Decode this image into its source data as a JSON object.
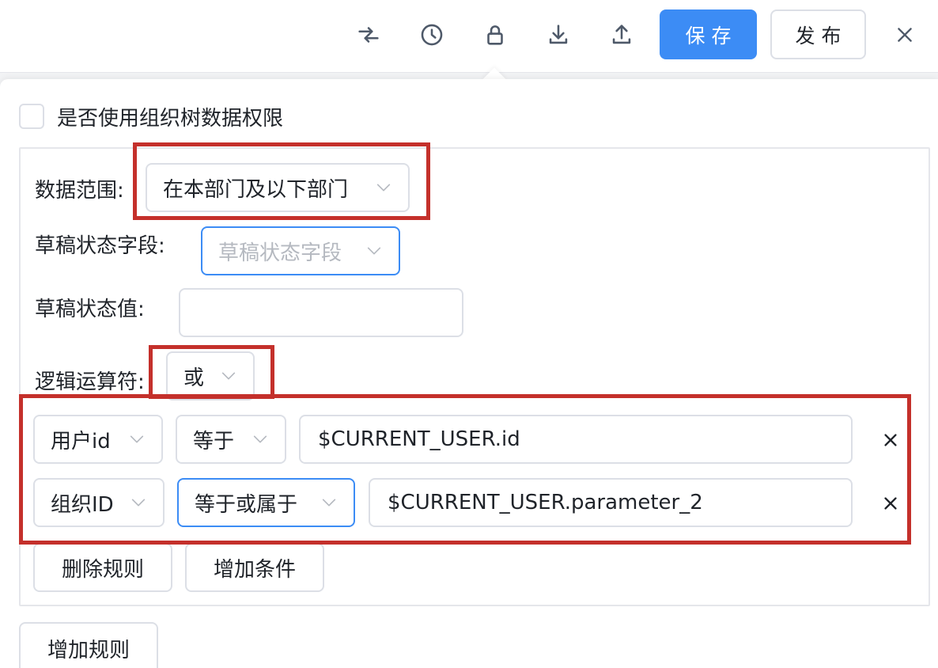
{
  "toolbar": {
    "icons": [
      "collapse-arrows-icon",
      "history-clock-icon",
      "lock-icon",
      "download-icon",
      "upload-icon"
    ],
    "save_label": "保存",
    "publish_label": "发布",
    "close_icon": "close-icon"
  },
  "panel": {
    "org_tree_checkbox": {
      "label": "是否使用组织树数据权限",
      "checked": false
    },
    "fields": {
      "data_scope": {
        "label": "数据范围:",
        "value": "在本部门及以下部门"
      },
      "draft_field": {
        "label": "草稿状态字段:",
        "placeholder": "草稿状态字段"
      },
      "draft_value": {
        "label": "草稿状态值:",
        "value": ""
      },
      "logic_op": {
        "label": "逻辑运算符:",
        "value": "或"
      }
    },
    "conditions": [
      {
        "field": "用户id",
        "operator": "等于",
        "value": "$CURRENT_USER.id"
      },
      {
        "field": "组织ID",
        "operator": "等于或属于",
        "value": "$CURRENT_USER.parameter_2"
      }
    ],
    "actions": {
      "delete_rule": "删除规则",
      "add_condition": "增加条件"
    },
    "add_rule": "增加规则"
  },
  "colors": {
    "primary": "#3c8cf5",
    "highlight": "#c4302b",
    "border": "#dcdfe6"
  }
}
